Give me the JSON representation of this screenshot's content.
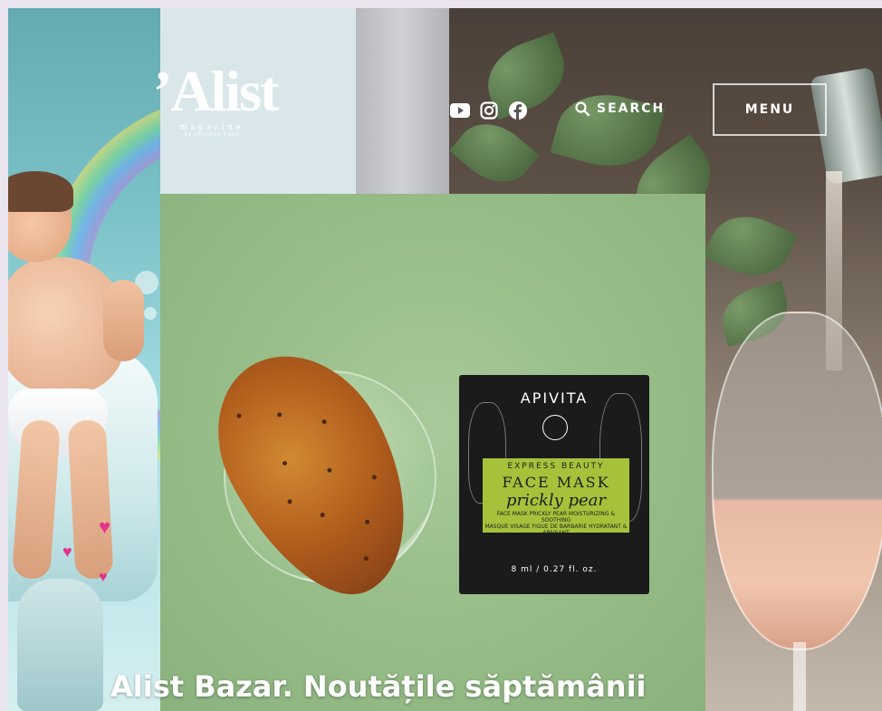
{
  "logo": {
    "main": "’Alist",
    "sub": "magazine",
    "by": "by Andreea Esca"
  },
  "header": {
    "social": [
      {
        "name": "youtube-icon"
      },
      {
        "name": "instagram-icon"
      },
      {
        "name": "facebook-icon"
      }
    ],
    "search_label": "SEARCH",
    "menu_label": "MENU"
  },
  "featured": {
    "headline": "Alist Bazar. Noutățile săptămânii",
    "product": {
      "brand": "APIVITA",
      "line": "EXPRESS BEAUTY",
      "name": "FACE MASK",
      "variant": "prickly pear",
      "fine_en": "FACE MASK PRICKLY PEAR MOISTURIZING & SOOTHING",
      "fine_fr": "MASQUE VISAGE FIGUE DE BARBARIE HYDRATANT & APAISANT",
      "volume": "8 ml / 0.27 fl. oz."
    }
  },
  "colors": {
    "card_bg": "#97bd88",
    "sachet_label": "#a6c23b",
    "header_text": "#ffffff"
  }
}
